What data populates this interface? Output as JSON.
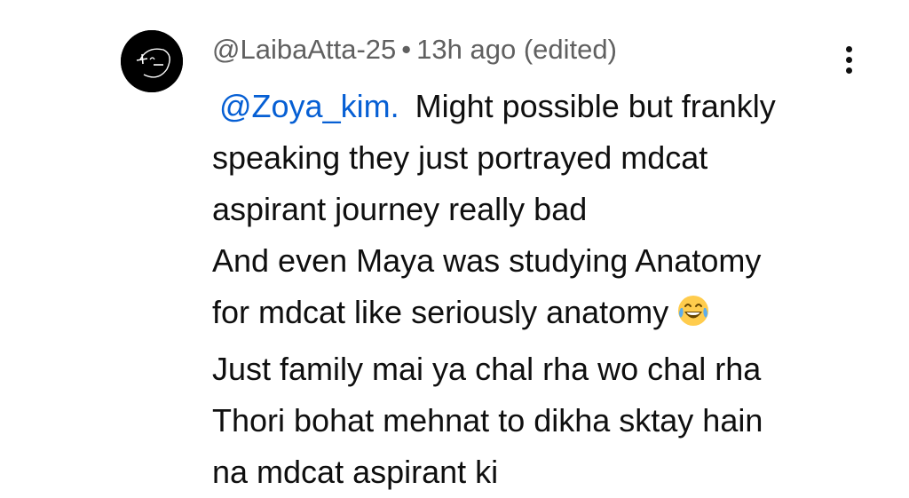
{
  "comment": {
    "author": "@LaibaAtta-25",
    "separator": "•",
    "timestamp": "13h ago",
    "edited": "(edited)",
    "mention": "@Zoya_kim.",
    "line1": "Might possible but frankly",
    "line2": "speaking they just portrayed mdcat",
    "line3": "aspirant journey really bad",
    "line4": "And even Maya was studying Anatomy",
    "line5": "for mdcat like seriously anatomy",
    "emoji": "face-with-tears-of-joy",
    "line6": "Just family mai ya chal rha wo chal rha",
    "line7": "Thori bohat mehnat to dikha sktay hain",
    "line8": "na mdcat aspirant ki"
  },
  "icons": {
    "avatar": "avatar-logo",
    "menu": "more-vertical-icon"
  },
  "colors": {
    "text": "#0f0f0f",
    "meta": "#606060",
    "mention": "#065fd4",
    "avatar_bg": "#000000"
  }
}
